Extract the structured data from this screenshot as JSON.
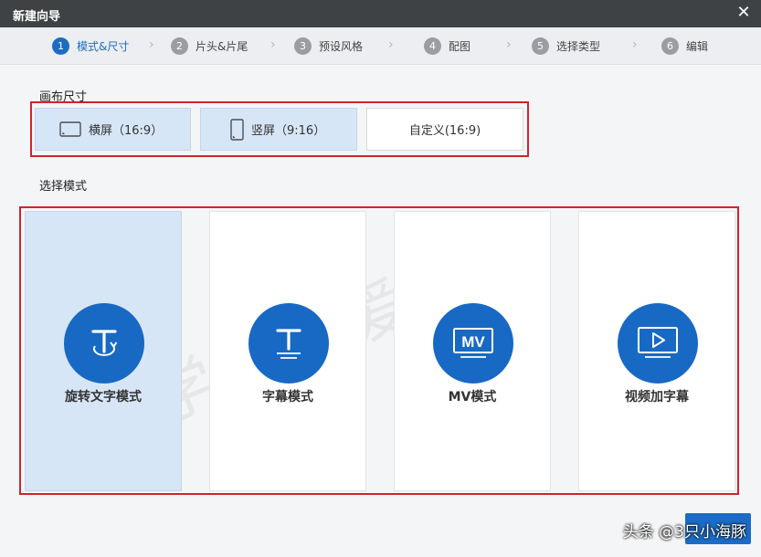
{
  "window": {
    "title": "新建向导",
    "close_glyph": "✕"
  },
  "steps": [
    {
      "num": "1",
      "label": "模式&尺寸",
      "active": true
    },
    {
      "num": "2",
      "label": "片头&片尾"
    },
    {
      "num": "3",
      "label": "预设风格"
    },
    {
      "num": "4",
      "label": "配图"
    },
    {
      "num": "5",
      "label": "选择类型"
    },
    {
      "num": "6",
      "label": "编辑"
    }
  ],
  "canvas": {
    "label": "画布尺寸",
    "options": [
      {
        "label": "横屏（16:9）",
        "icon": "landscape-screen-icon"
      },
      {
        "label": "竖屏（9:16）",
        "icon": "portrait-screen-icon"
      },
      {
        "label": "自定义(16:9)"
      }
    ]
  },
  "mode": {
    "label": "选择模式",
    "cards": [
      {
        "label": "旋转文字模式",
        "icon": "rotate-text-icon",
        "selected": true
      },
      {
        "label": "字幕模式",
        "icon": "subtitle-text-icon"
      },
      {
        "label": "MV模式",
        "icon": "mv-icon",
        "icon_text": "MV"
      },
      {
        "label": "视频加字幕",
        "icon": "video-play-icon"
      }
    ]
  },
  "watermark": "学知识爱生活",
  "credit": "头条 @3只小海豚",
  "colors": {
    "accent": "#1869c4",
    "highlight": "#d7e6f6",
    "annotation": "#d3232b",
    "titlebar": "#3f4244"
  }
}
